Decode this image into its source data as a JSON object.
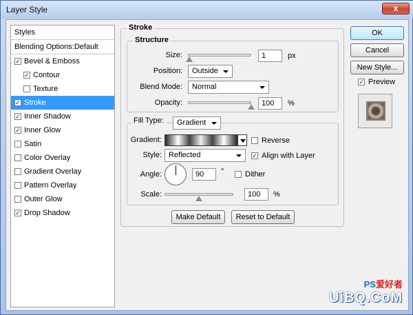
{
  "window": {
    "title": "Layer Style",
    "close_label": "x"
  },
  "styles_panel": {
    "header": "Styles",
    "blending_options": "Blending Options:Default",
    "items": [
      {
        "label": "Bevel & Emboss",
        "checked": true,
        "sub": false,
        "selected": false
      },
      {
        "label": "Contour",
        "checked": true,
        "sub": true,
        "selected": false
      },
      {
        "label": "Texture",
        "checked": false,
        "sub": true,
        "selected": false
      },
      {
        "label": "Stroke",
        "checked": true,
        "sub": false,
        "selected": true
      },
      {
        "label": "Inner Shadow",
        "checked": true,
        "sub": false,
        "selected": false
      },
      {
        "label": "Inner Glow",
        "checked": true,
        "sub": false,
        "selected": false
      },
      {
        "label": "Satin",
        "checked": false,
        "sub": false,
        "selected": false
      },
      {
        "label": "Color Overlay",
        "checked": false,
        "sub": false,
        "selected": false
      },
      {
        "label": "Gradient Overlay",
        "checked": false,
        "sub": false,
        "selected": false
      },
      {
        "label": "Pattern Overlay",
        "checked": false,
        "sub": false,
        "selected": false
      },
      {
        "label": "Outer Glow",
        "checked": false,
        "sub": false,
        "selected": false
      },
      {
        "label": "Drop Shadow",
        "checked": true,
        "sub": false,
        "selected": false
      }
    ]
  },
  "stroke": {
    "group_title": "Stroke",
    "structure": {
      "title": "Structure",
      "size_label": "Size:",
      "size_value": "1",
      "size_unit": "px",
      "size_slider": 0.02,
      "position_label": "Position:",
      "position_value": "Outside",
      "blend_mode_label": "Blend Mode:",
      "blend_mode_value": "Normal",
      "opacity_label": "Opacity:",
      "opacity_value": "100",
      "opacity_unit": "%",
      "opacity_slider": 1.0
    },
    "fill": {
      "fill_type_label": "Fill Type:",
      "fill_type_value": "Gradient",
      "gradient_label": "Gradient:",
      "reverse_label": "Reverse",
      "reverse_checked": false,
      "style_label": "Style:",
      "style_value": "Reflected",
      "align_label": "Align with Layer",
      "align_checked": true,
      "angle_label": "Angle:",
      "angle_value": "90",
      "angle_unit": "°",
      "dither_label": "Dither",
      "dither_checked": false,
      "scale_label": "Scale:",
      "scale_value": "100",
      "scale_unit": "%",
      "scale_slider": 0.5
    },
    "make_default": "Make Default",
    "reset_default": "Reset to Default"
  },
  "buttons": {
    "ok": "OK",
    "cancel": "Cancel",
    "new_style": "New Style...",
    "preview_label": "Preview",
    "preview_checked": true
  },
  "watermark": {
    "top_latin": "PS",
    "top_cn": "爱好者",
    "bottom": "UiBQ.CoM"
  }
}
